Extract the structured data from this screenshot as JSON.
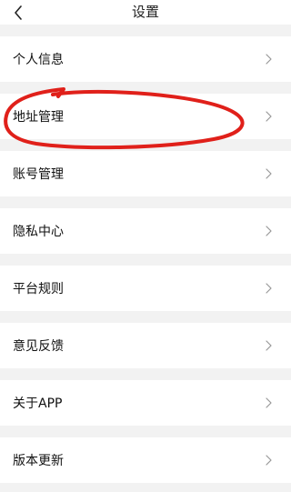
{
  "header": {
    "title": "设置",
    "back_icon": "chevron-left-icon"
  },
  "menu": {
    "items": [
      {
        "label": "个人信息",
        "icon": "chevron-right-icon"
      },
      {
        "label": "地址管理",
        "icon": "chevron-right-icon"
      },
      {
        "label": "账号管理",
        "icon": "chevron-right-icon"
      },
      {
        "label": "隐私中心",
        "icon": "chevron-right-icon"
      },
      {
        "label": "平台规则",
        "icon": "chevron-right-icon"
      },
      {
        "label": "意见反馈",
        "icon": "chevron-right-icon"
      },
      {
        "label": "关于APP",
        "icon": "chevron-right-icon"
      },
      {
        "label": "版本更新",
        "icon": "chevron-right-icon"
      }
    ]
  },
  "colors": {
    "background": "#f2f2f2",
    "row_background": "#ffffff",
    "text": "#111111",
    "chevron": "#999999",
    "annotation": "#e0201a"
  }
}
